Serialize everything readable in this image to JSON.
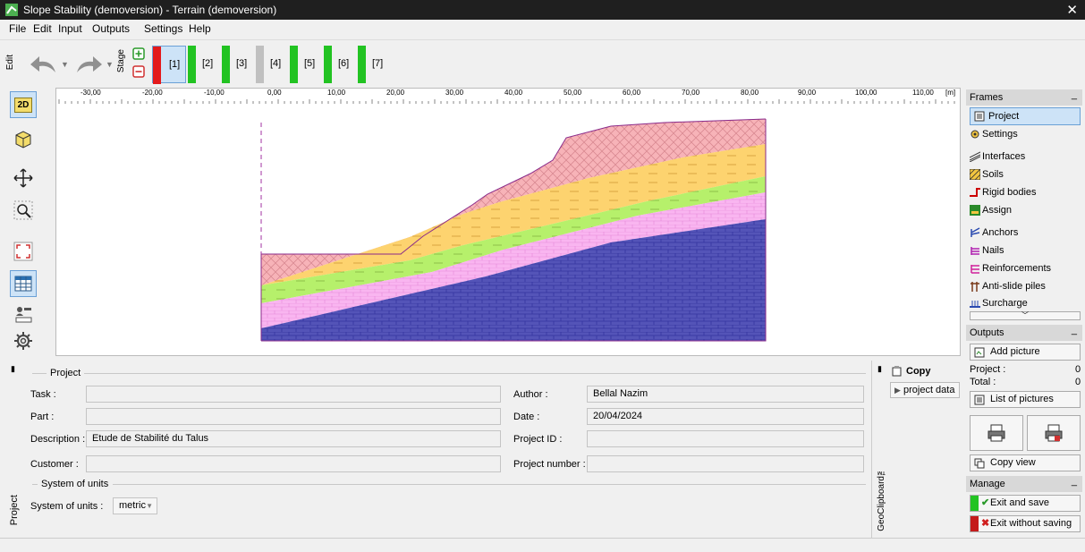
{
  "window": {
    "title": "Slope Stability (demoversion) - Terrain (demoversion)",
    "close": "✕"
  },
  "menu": [
    "File",
    "Edit",
    "Input",
    "Outputs",
    "Settings",
    "Help"
  ],
  "toolbar": {
    "edit_label": "Edit",
    "stage_label": "Stage",
    "stages": [
      {
        "label": "[1]",
        "color": "#e31a1c",
        "active": true
      },
      {
        "label": "[2]",
        "color": "#22c322",
        "active": false
      },
      {
        "label": "[3]",
        "color": "#22c322",
        "active": false
      },
      {
        "label": "[4]",
        "color": "#c0c0c0",
        "active": false
      },
      {
        "label": "[5]",
        "color": "#22c322",
        "active": false
      },
      {
        "label": "[6]",
        "color": "#22c322",
        "active": false
      },
      {
        "label": "[7]",
        "color": "#22c322",
        "active": false
      }
    ]
  },
  "leftbar": {
    "btn_2d": "2D",
    "btn_3d": "3D"
  },
  "ruler": {
    "ticks": [
      "-30,00",
      "-20,00",
      "-10,00",
      "0,00",
      "10,00",
      "20,00",
      "30,00",
      "40,00",
      "50,00",
      "60,00",
      "70,00",
      "80,00",
      "90,00",
      "100,00",
      "110,00"
    ],
    "unit": "[m]"
  },
  "frames": {
    "header": "Frames",
    "items": [
      "Project",
      "Settings",
      "Interfaces",
      "Soils",
      "Rigid bodies",
      "Assign",
      "Anchors",
      "Nails",
      "Reinforcements",
      "Anti-slide piles",
      "Surcharge"
    ]
  },
  "outputs": {
    "header": "Outputs",
    "add_picture": "Add picture",
    "project_label": "Project :",
    "project_count": "0",
    "total_label": "Total :",
    "total_count": "0",
    "list_pictures": "List of pictures",
    "copy_view": "Copy view"
  },
  "manage": {
    "header": "Manage",
    "exit_save": "Exit and save",
    "exit_nosave": "Exit without saving"
  },
  "project": {
    "section": "Project",
    "tab": "Project",
    "task_label": "Task :",
    "task_value": "",
    "part_label": "Part :",
    "part_value": "",
    "description_label": "Description :",
    "description_value": "Etude de Stabilité du Talus",
    "customer_label": "Customer :",
    "customer_value": "",
    "author_label": "Author :",
    "author_value": "Bellal Nazim",
    "date_label": "Date :",
    "date_value": "20/04/2024",
    "projectid_label": "Project ID :",
    "projectid_value": "",
    "projectnum_label": "Project number :",
    "projectnum_value": "",
    "units_section": "System of units",
    "units_label": "System of units :",
    "units_value": "metric"
  },
  "clipboard": {
    "copy": "Copy",
    "project_data": "project data",
    "tab": "GeoClipboard™"
  },
  "colors": {
    "layer_top": "#f7b3b8",
    "layer_yellow": "#fdd36f",
    "layer_green": "#b6f06b",
    "layer_pink": "#f9b5f0",
    "layer_blue": "#5454b8"
  }
}
